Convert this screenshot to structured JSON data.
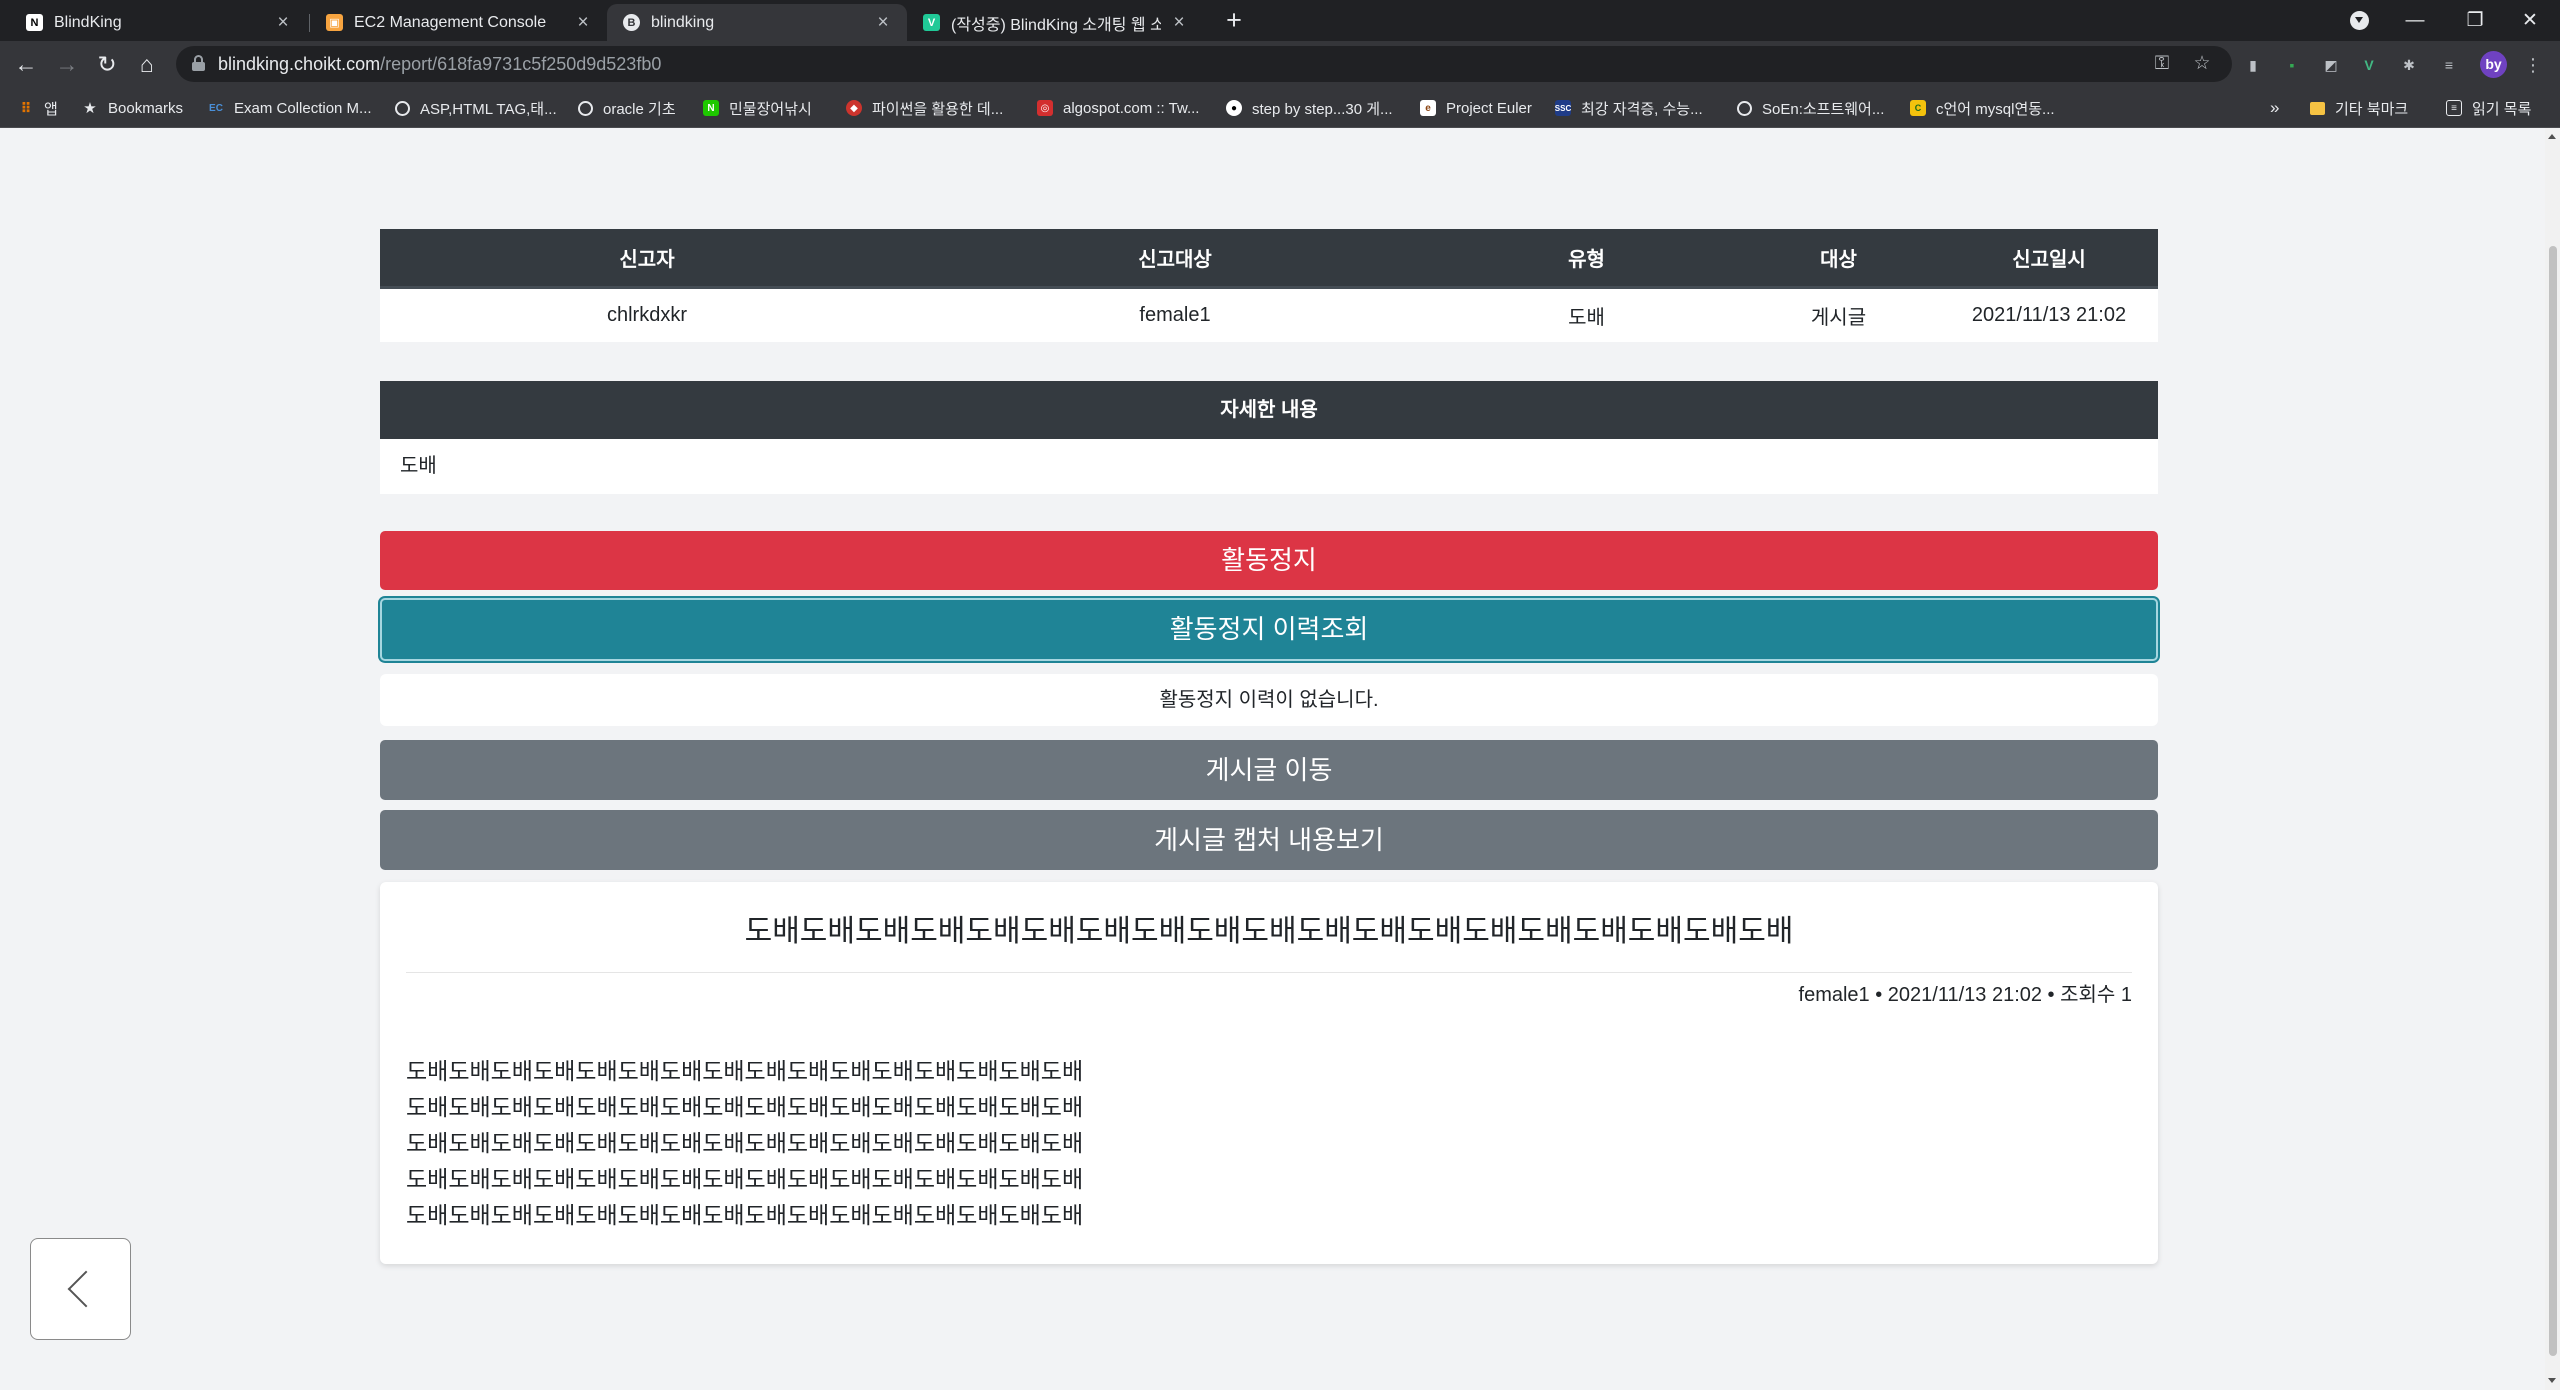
{
  "browser": {
    "tabs": [
      {
        "title": "BlindKing",
        "favicon": "notion-icon",
        "active": false
      },
      {
        "title": "EC2 Management Console",
        "favicon": "aws-icon",
        "active": false
      },
      {
        "title": "blindking",
        "favicon": "bootstrap-icon",
        "active": true
      },
      {
        "title": "(작성중) BlindKing 소개팅 웹 소",
        "favicon": "velog-icon",
        "active": false
      }
    ],
    "url_host": "blindking.choikt.com",
    "url_path": "/report/618fa9731c5f250d9d523fb0",
    "profile_initials": "by",
    "bookmarks": [
      {
        "label": "앱",
        "icon": "apps-grid-icon"
      },
      {
        "label": "Bookmarks",
        "icon": "star-icon"
      },
      {
        "label": "Exam Collection M...",
        "icon": "ec-icon"
      },
      {
        "label": "ASP,HTML TAG,태...",
        "icon": "globe-icon"
      },
      {
        "label": "oracle 기초",
        "icon": "globe-icon"
      },
      {
        "label": "민물장어낚시",
        "icon": "naver-icon"
      },
      {
        "label": "파이썬을 활용한 데...",
        "icon": "ruby-icon"
      },
      {
        "label": "algospot.com :: Tw...",
        "icon": "algospot-icon"
      },
      {
        "label": "step by step...30 게...",
        "icon": "github-icon"
      },
      {
        "label": "Project Euler",
        "icon": "euler-icon"
      },
      {
        "label": "최강 자격증, 수능...",
        "icon": "ssc-icon"
      },
      {
        "label": "SoEn:소프트웨어...",
        "icon": "globe-icon"
      },
      {
        "label": "c언어 mysql연동...",
        "icon": "mysql-icon"
      },
      {
        "label": "»",
        "icon": ""
      },
      {
        "label": "기타 북마크",
        "icon": "folder-icon"
      },
      {
        "label": "읽기 목록",
        "icon": "reading-list-icon"
      }
    ]
  },
  "report": {
    "columns": [
      "신고자",
      "신고대상",
      "유형",
      "대상",
      "신고일시"
    ],
    "row": [
      "chlrkdxkr",
      "female1",
      "도배",
      "게시글",
      "2021/11/13 21:02"
    ]
  },
  "detail": {
    "heading": "자세한 내용",
    "text": "도배"
  },
  "actions": {
    "suspend": "활동정지",
    "suspend_history": "활동정지 이력조회",
    "history_empty": "활동정지 이력이 없습니다.",
    "goto_post": "게시글 이동",
    "view_capture": "게시글 캡처 내용보기"
  },
  "post": {
    "title": "도배도배도배도배도배도배도배도배도배도배도배도배도배도배도배도배도배도배도배",
    "meta": "female1 • 2021/11/13 21:02 • 조회수 1",
    "body": "도배도배도배도배도배도배도배도배도배도배도배도배도배도배도배도배\n도배도배도배도배도배도배도배도배도배도배도배도배도배도배도배도배\n도배도배도배도배도배도배도배도배도배도배도배도배도배도배도배도배\n도배도배도배도배도배도배도배도배도배도배도배도배도배도배도배도배\n도배도배도배도배도배도배도배도배도배도배도배도배도배도배도배도배"
  },
  "colors": {
    "danger": "#dc3545",
    "info": "#1f8496",
    "secondary": "#6c757d",
    "table_header": "#343a40"
  }
}
